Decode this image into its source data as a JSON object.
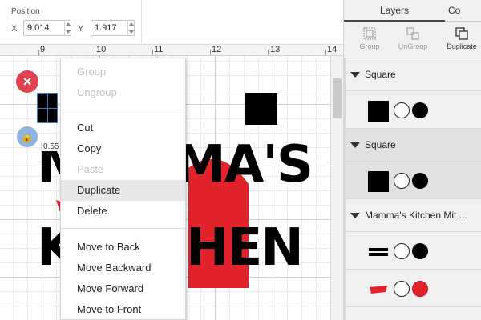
{
  "position": {
    "title": "Position",
    "x_label": "X",
    "x_value": "9.014",
    "y_label": "Y",
    "y_value": "1.917"
  },
  "ruler": {
    "numbers": [
      "9",
      "10",
      "11",
      "12",
      "13",
      "14"
    ]
  },
  "canvas": {
    "dimension_label": "0.55",
    "design_top_text": "MA'S",
    "design_bottom_text": "HEN",
    "design_left_text": "M",
    "design_left_bottom_text": "K"
  },
  "context_menu": {
    "items": [
      {
        "label": "Group",
        "state": "disabled"
      },
      {
        "label": "Ungroup",
        "state": "disabled"
      },
      {
        "label": "Cut",
        "state": "enabled"
      },
      {
        "label": "Copy",
        "state": "enabled"
      },
      {
        "label": "Paste",
        "state": "disabled"
      },
      {
        "label": "Duplicate",
        "state": "hover"
      },
      {
        "label": "Delete",
        "state": "enabled"
      },
      {
        "label": "Move to Back",
        "state": "enabled"
      },
      {
        "label": "Move Backward",
        "state": "enabled"
      },
      {
        "label": "Move Forward",
        "state": "enabled"
      },
      {
        "label": "Move to Front",
        "state": "enabled"
      }
    ]
  },
  "panel": {
    "tabs": [
      {
        "label": "Layers"
      },
      {
        "label": "Co"
      }
    ],
    "toolbar": [
      {
        "label": "Group",
        "icon": "group-icon"
      },
      {
        "label": "UnGroup",
        "icon": "ungroup-icon"
      },
      {
        "label": "Duplicate",
        "icon": "duplicate-icon"
      }
    ],
    "layers": [
      {
        "name": "Square",
        "fill_color": "#000000"
      },
      {
        "name": "Square",
        "fill_color": "#000000"
      },
      {
        "name": "Mamma's Kitchen Mit ...",
        "fill_color": "#000000",
        "second_color": "#e3232c"
      }
    ]
  },
  "colors": {
    "accent_red": "#e3232c",
    "close_red": "#e0424f",
    "lock_blue": "#8fb4e0",
    "selection_blue": "#3a77c4"
  }
}
